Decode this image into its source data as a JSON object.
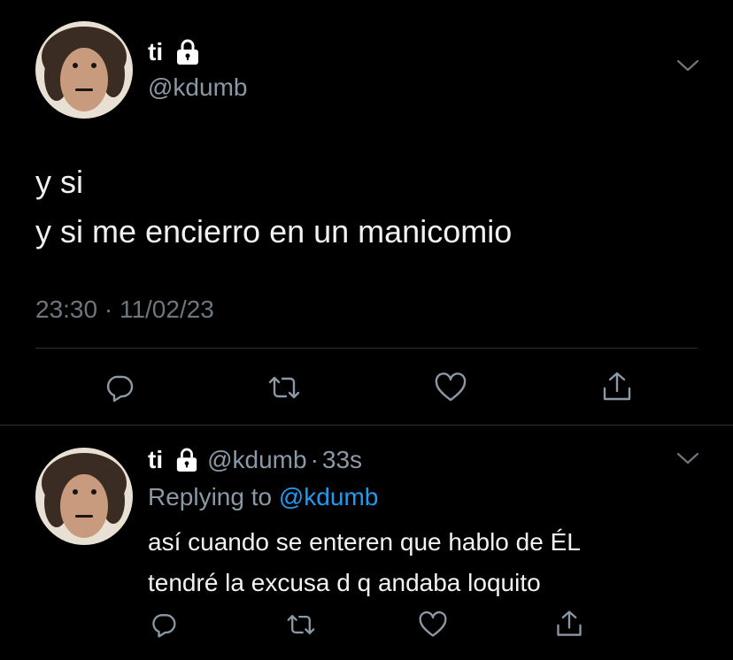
{
  "main_tweet": {
    "display_name": "ti",
    "handle": "@kdumb",
    "text_lines": [
      "y si",
      "y si me encierro en un manicomio"
    ],
    "timestamp": "23:30 · 11/02/23",
    "icons": {
      "lock": "lock-icon",
      "more": "chevron-down-icon",
      "reply": "comment-icon",
      "retweet": "retweet-icon",
      "like": "heart-icon",
      "share": "share-icon"
    }
  },
  "reply_tweet": {
    "display_name": "ti",
    "handle": "@kdumb",
    "separator": "·",
    "time_ago": "33s",
    "replying_prefix": "Replying to",
    "replying_to": "@kdumb",
    "text_lines": [
      "así cuando se enteren que hablo de ÉL",
      "tendré la excusa d q andaba loquito"
    ]
  },
  "colors": {
    "background": "#000000",
    "primary_text": "#ffffff",
    "secondary_text": "#8b98a5",
    "link": "#1d9bf0",
    "divider": "#2f3336"
  }
}
